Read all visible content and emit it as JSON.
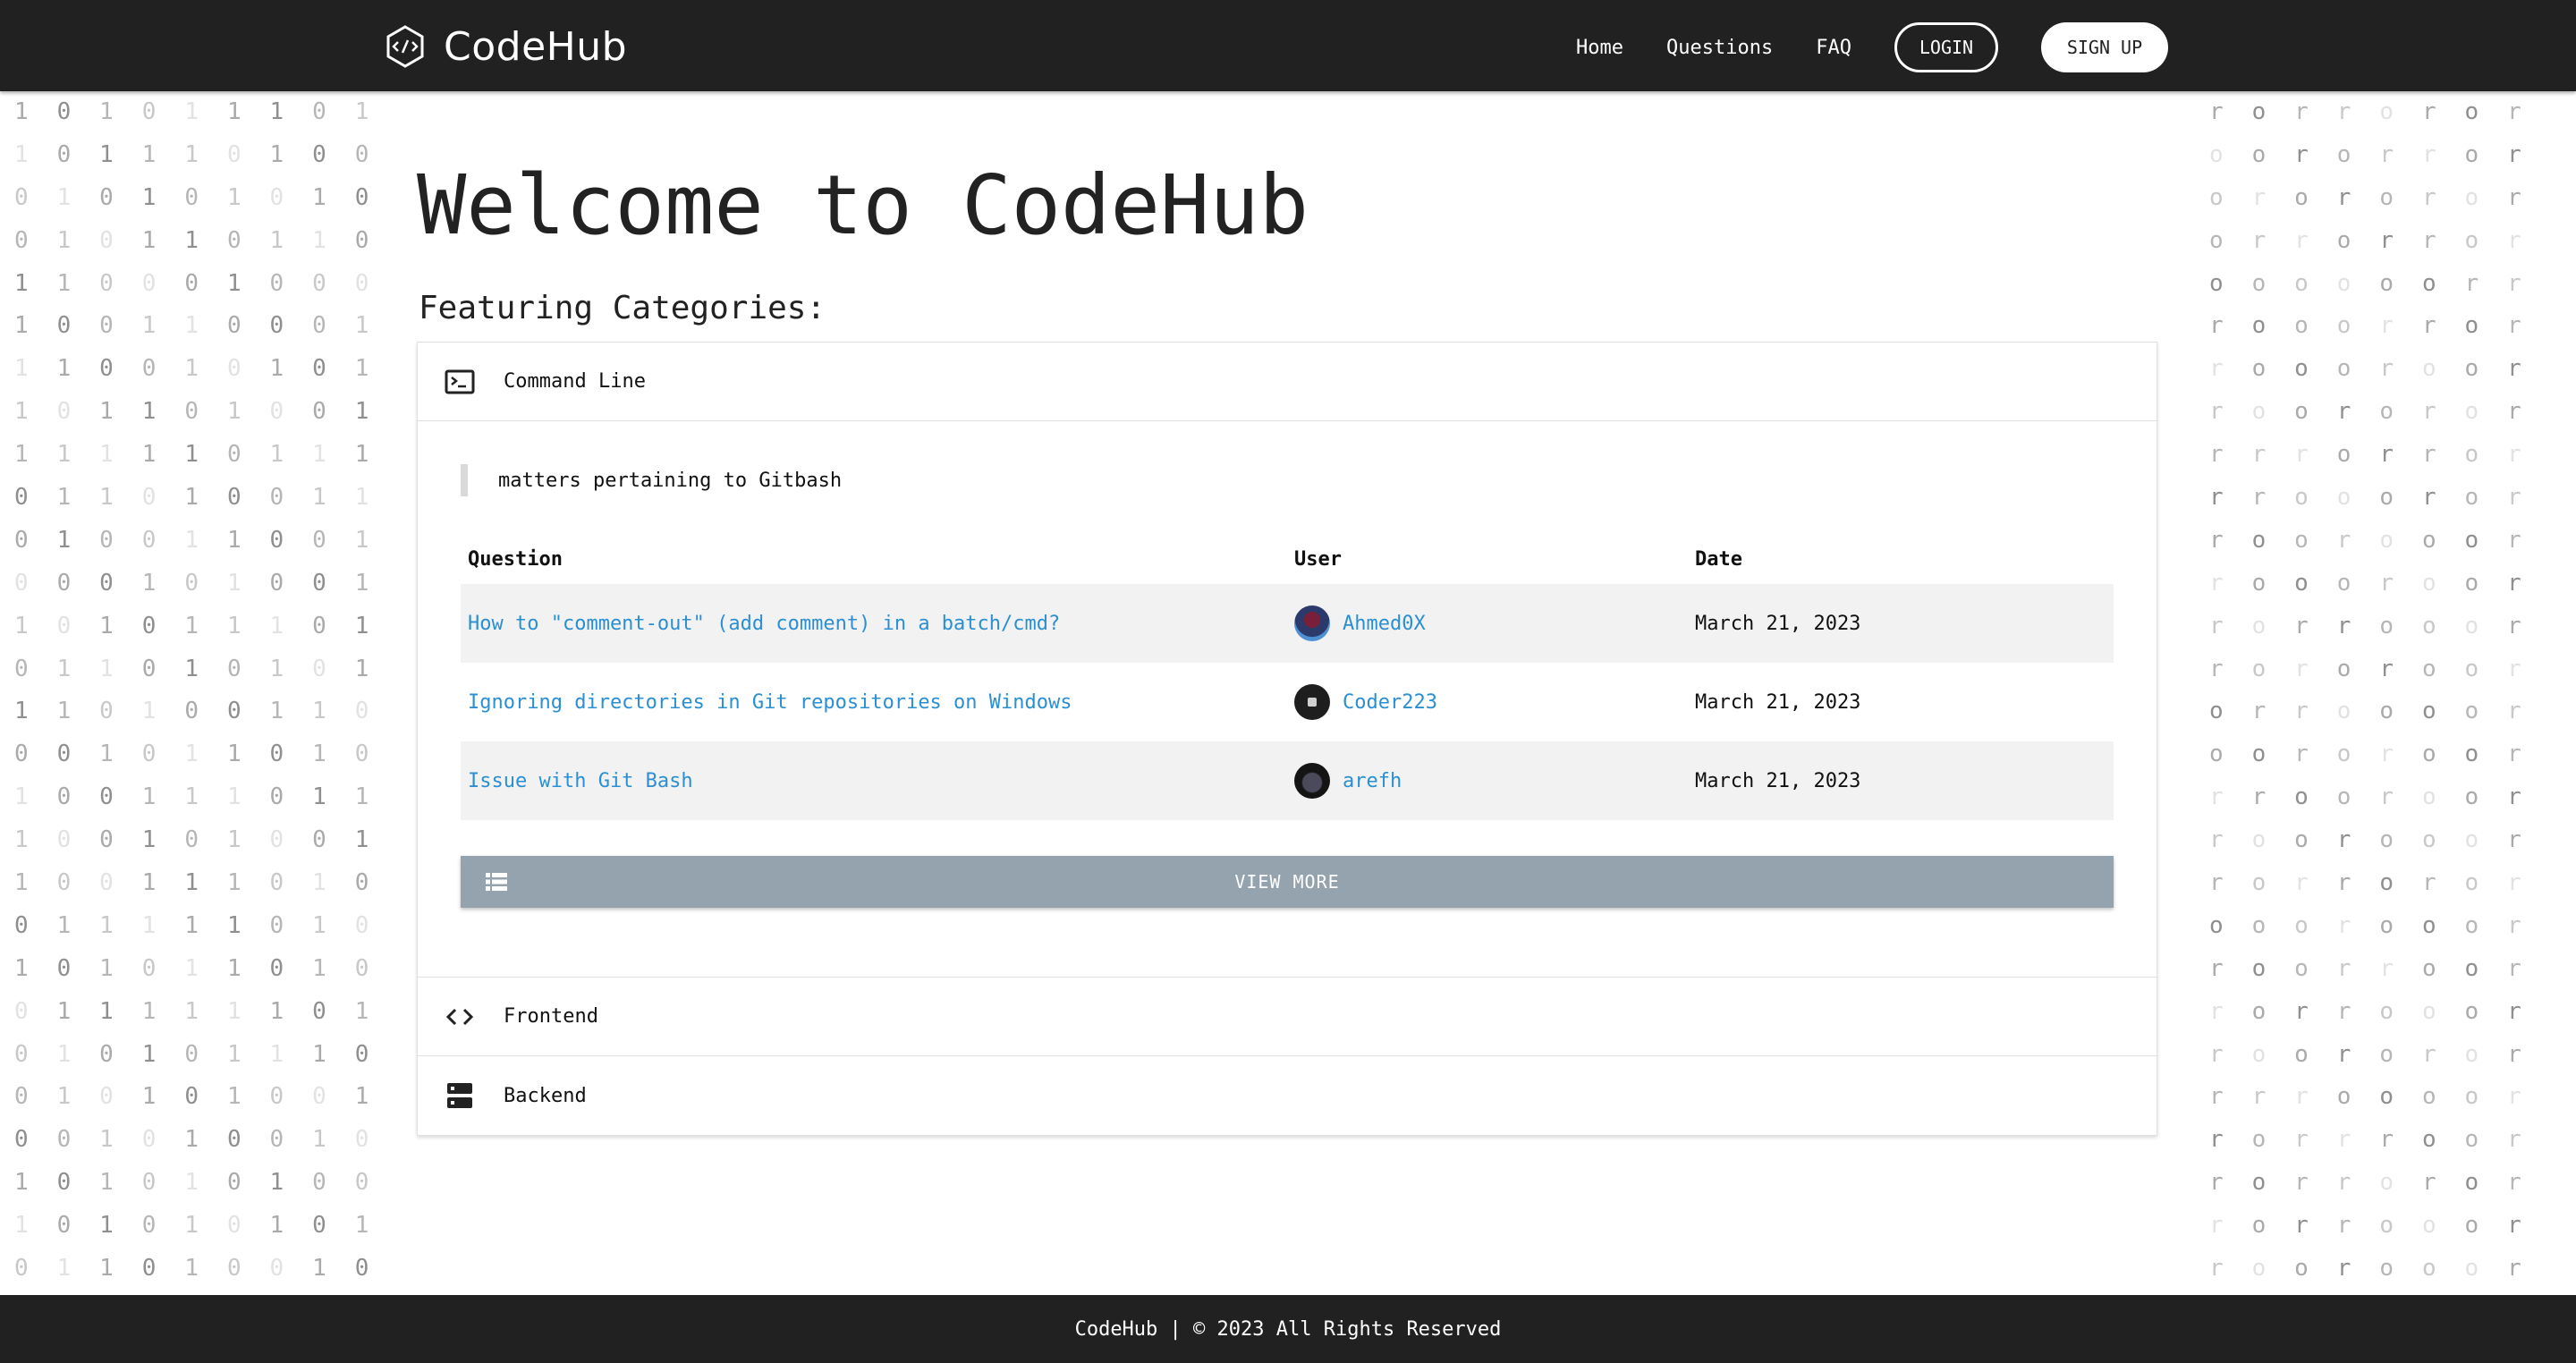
{
  "header": {
    "brand": "CodeHub",
    "logo_icon": "code-hexagon-icon",
    "nav": [
      "Home",
      "Questions",
      "FAQ"
    ],
    "login_label": "LOGIN",
    "signup_label": "SIGN UP"
  },
  "decor": {
    "left_rows": [
      "1 0 1 0 1 1 1 0 1",
      "1 0 1 1 1 0 1 0 0",
      "0 1 0 1 0 1 0 1 0",
      "0 1 0 1 1 0 1 1 0",
      "1 1 0 0 0 1 0 0 0",
      "1 0 0 1 1 0 0 0 1",
      "1 1 0 0 1 0 1 0 1",
      "1 0 1 1 0 1 0 0 1",
      "1 1 1 1 1 0 1 1 1",
      "0 1 1 0 1 0 0 1 1",
      "0 1 0 0 1 1 0 0 1",
      "0 0 0 1 0 1 0 0 1",
      "1 0 1 0 1 1 1 0 1",
      "0 1 1 0 1 0 1 0 1",
      "1 1 0 1 0 0 1 1 0",
      "0 0 1 0 1 1 0 1 0",
      "1 0 0 1 1 1 0 1 1",
      "1 0 0 1 0 1 0 0 1",
      "1 0 0 1 1 1 0 1 0",
      "0 1 1 1 1 1 0 1 0",
      "1 0 1 0 1 1 0 1 0",
      "0 1 1 1 1 1 1 0 1",
      "0 1 0 1 0 1 1 1 0",
      "0 1 0 1 0 1 0 0 1",
      "0 0 1 0 1 0 0 1 0",
      "1 0 1 0 1 0 1 0 0",
      "1 0 1 0 1 0 1 0 1",
      "0 1 1 0 1 0 0 1 0"
    ],
    "right_rows": [
      "r o r r o r o r",
      "o o r o r r o r",
      "o r o r o r o r",
      "o r r o r r o r",
      "o o o o o o r r",
      "r o o o r r o r",
      "r o o o r o o r",
      "r o o r o r o r",
      "r r r o r r o r",
      "r r o o o r o r",
      "r o o r o o o r",
      "r o o o r o o r",
      "r o r r o o o r",
      "r o r o r o o r",
      "o r r o o o o r",
      "o o r o r o o r",
      "r r o o r o o r",
      "r o o r o o o r",
      "r o r r o r o r",
      "o o o r o o o r",
      "r o o r r o o r",
      "r o r r o o o r",
      "r o o r o r o r",
      "r r r o o o o r",
      "r o r r r o o r",
      "r o r r o r o r",
      "r o r r o o o r",
      "r o o r o o o r"
    ]
  },
  "main": {
    "title": "Welcome to CodeHub",
    "subtitle": "Featuring Categories:"
  },
  "categories": [
    {
      "icon": "terminal-icon",
      "label": "Command Line",
      "description": "matters pertaining to Gitbash",
      "table": {
        "headers": [
          "Question",
          "User",
          "Date"
        ],
        "rows": [
          {
            "question": "How to \"comment-out\" (add comment) in a batch/cmd?",
            "user": "Ahmed0X",
            "date": "March 21, 2023"
          },
          {
            "question": "Ignoring directories in Git repositories on Windows",
            "user": "Coder223",
            "date": "March 21, 2023"
          },
          {
            "question": "Issue with Git Bash",
            "user": "arefh",
            "date": "March 21, 2023"
          }
        ]
      },
      "view_more": "VIEW MORE",
      "view_more_icon": "list-icon"
    },
    {
      "icon": "code-brackets-icon",
      "label": "Frontend"
    },
    {
      "icon": "server-icon",
      "label": "Backend"
    }
  ],
  "footer": {
    "text": "CodeHub | © 2023 All Rights Reserved"
  }
}
